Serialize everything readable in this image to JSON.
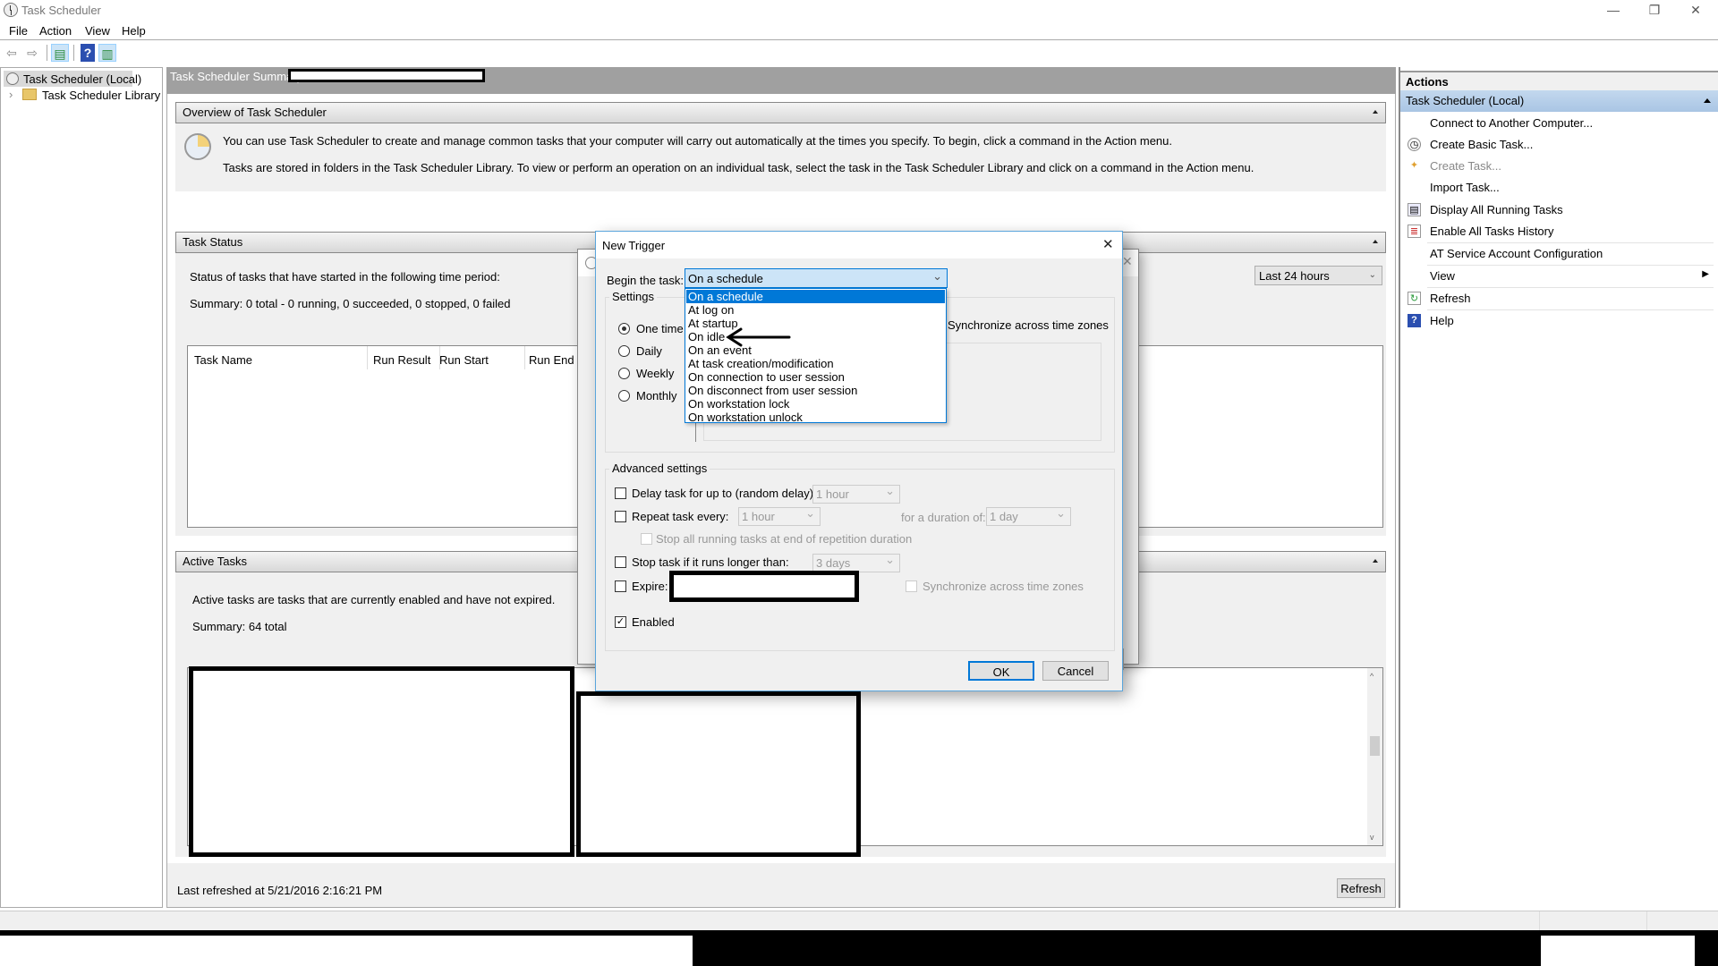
{
  "window": {
    "title": "Task Scheduler",
    "controls": {
      "minimize": "—",
      "restore": "❐",
      "close": "✕"
    }
  },
  "menu": [
    "File",
    "Action",
    "View",
    "Help"
  ],
  "toolbar": [
    {
      "icon": "back-arrow-icon",
      "glyph": "⇦"
    },
    {
      "icon": "forward-arrow-icon",
      "glyph": "⇨"
    },
    {
      "icon": "show-hide-console-tree-icon",
      "glyph": "▤"
    },
    {
      "icon": "help-icon",
      "glyph": "?"
    },
    {
      "icon": "show-hide-action-pane-icon",
      "glyph": "▥"
    }
  ],
  "tree": {
    "root": "Task Scheduler (Local)",
    "child": "Task Scheduler Library",
    "expander": "›"
  },
  "main": {
    "header": "Task Scheduler Summary",
    "overview": {
      "title": "Overview of Task Scheduler",
      "line1": "You can use Task Scheduler to create and manage common tasks that your computer will carry out automatically at the times you specify. To begin, click a command in the Action menu.",
      "line2": "Tasks are stored in folders in the Task Scheduler Library. To view or perform an operation on an individual task, select the task in the Task Scheduler Library and click on a command in the Action menu."
    },
    "task_status": {
      "title": "Task Status",
      "period_label": "Status of tasks that have started in the following time period:",
      "period_value": "Last 24 hours",
      "summary": "Summary: 0 total - 0 running, 0 succeeded, 0 stopped, 0 failed",
      "columns": [
        "Task Name",
        "Run Result",
        "Run Start",
        "Run End"
      ]
    },
    "active_tasks": {
      "title": "Active Tasks",
      "description": "Active tasks are tasks that are currently enabled and have not expired.",
      "summary": "Summary: 64 total"
    },
    "last_refreshed": "Last refreshed at 5/21/2016 2:16:21 PM",
    "refresh_button": "Refresh"
  },
  "actions": {
    "header": "Actions",
    "group": "Task Scheduler (Local)",
    "items": [
      {
        "label": "Connect to Another Computer...",
        "icon": "",
        "enabled": true
      },
      {
        "label": "Create Basic Task...",
        "icon": "create-basic-task-icon",
        "enabled": true
      },
      {
        "label": "Create Task...",
        "icon": "create-task-icon",
        "enabled": false
      },
      {
        "label": "Import Task...",
        "icon": "",
        "enabled": true
      },
      {
        "label": "Display All Running Tasks",
        "icon": "running-tasks-icon",
        "enabled": true
      },
      {
        "label": "Enable All Tasks History",
        "icon": "history-icon",
        "enabled": true
      },
      {
        "label": "AT Service Account Configuration",
        "icon": "",
        "enabled": true
      },
      {
        "label": "View",
        "icon": "",
        "enabled": true,
        "submenu": "▶"
      },
      {
        "label": "Refresh",
        "icon": "refresh-icon",
        "enabled": true
      },
      {
        "label": "Help",
        "icon": "help-icon",
        "enabled": true
      }
    ]
  },
  "dialog": {
    "title": "New Trigger",
    "close": "✕",
    "begin_label": "Begin the task:",
    "begin_value": "On a schedule",
    "begin_options": [
      "On a schedule",
      "At log on",
      "At startup",
      "On idle",
      "On an event",
      "At task creation/modification",
      "On connection to user session",
      "On disconnect from user session",
      "On workstation lock",
      "On workstation unlock"
    ],
    "settings": {
      "label": "Settings",
      "options": [
        "One time",
        "Daily",
        "Weekly",
        "Monthly"
      ],
      "selected": "One time",
      "sync_label": "Synchronize across time zones"
    },
    "advanced": {
      "label": "Advanced settings",
      "delay_label": "Delay task for up to (random delay):",
      "delay_value": "1 hour",
      "delay_checked": false,
      "repeat_label": "Repeat task every:",
      "repeat_value": "1 hour",
      "repeat_checked": false,
      "duration_label": "for a duration of:",
      "duration_value": "1 day",
      "stop_all_label": "Stop all running tasks at end of repetition duration",
      "stop_label": "Stop task if it runs longer than:",
      "stop_value": "3 days",
      "stop_checked": false,
      "expire_label": "Expire:",
      "expire_checked": false,
      "sync_label": "Synchronize across time zones",
      "enabled_label": "Enabled",
      "enabled_checked": true
    },
    "ok": "OK",
    "cancel": "Cancel"
  },
  "annotation": {
    "type": "hand-drawn-arrow",
    "points_to": "On idle"
  }
}
